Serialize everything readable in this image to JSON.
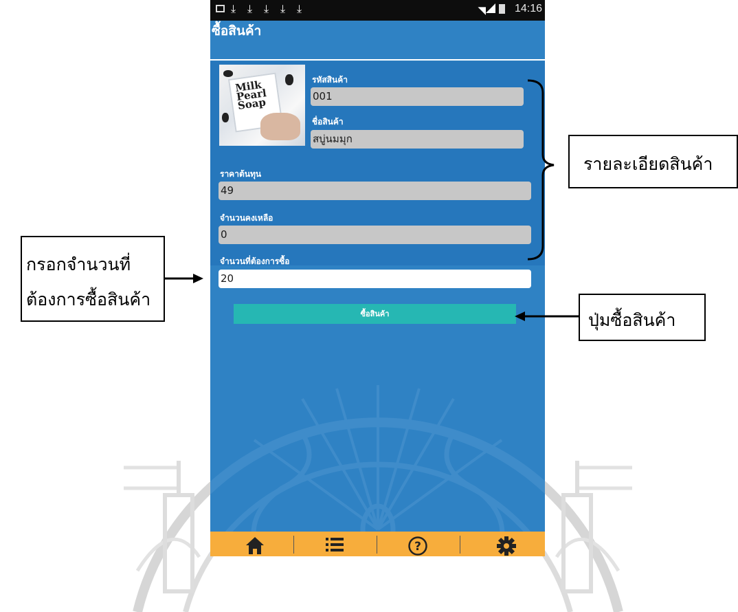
{
  "status_bar": {
    "time": "14:16",
    "download_icons": [
      "download-icon",
      "download-icon",
      "download-icon",
      "download-icon",
      "download-icon"
    ]
  },
  "app_bar": {
    "title": "ซื้อสินค้า"
  },
  "product": {
    "code_label": "รหัสสินค้า",
    "code_value": "001",
    "name_label": "ชื่อสินค้า",
    "name_value": "สบู่นมมุก",
    "cost_label": "ราคาต้นทุน",
    "cost_value": "49",
    "stock_label": "จำนวนคงเหลือ",
    "stock_value": "0",
    "image_text": "Milk Pearl Soap"
  },
  "purchase": {
    "qty_label": "จำนวนที่ต้องการซื้อ",
    "qty_value": "20",
    "buy_button": "ซื้อสินค้า"
  },
  "bottom_nav": [
    "home-icon",
    "list-icon",
    "help-icon",
    "settings-icon"
  ],
  "annotations": {
    "details": "รายละเอียดสินค้า",
    "enter_qty_line1": "กรอกจำนวนที่",
    "enter_qty_line2": "ต้องการซื้อสินค้า",
    "buy_button": "ปุ่มซื้อสินค้า"
  },
  "colors": {
    "app_background": "#2f82c4",
    "details_panel": "#2677bc",
    "readonly_field": "#c7c7c7",
    "buy_button": "#26b7b3",
    "bottom_nav": "#f7ad3c"
  }
}
